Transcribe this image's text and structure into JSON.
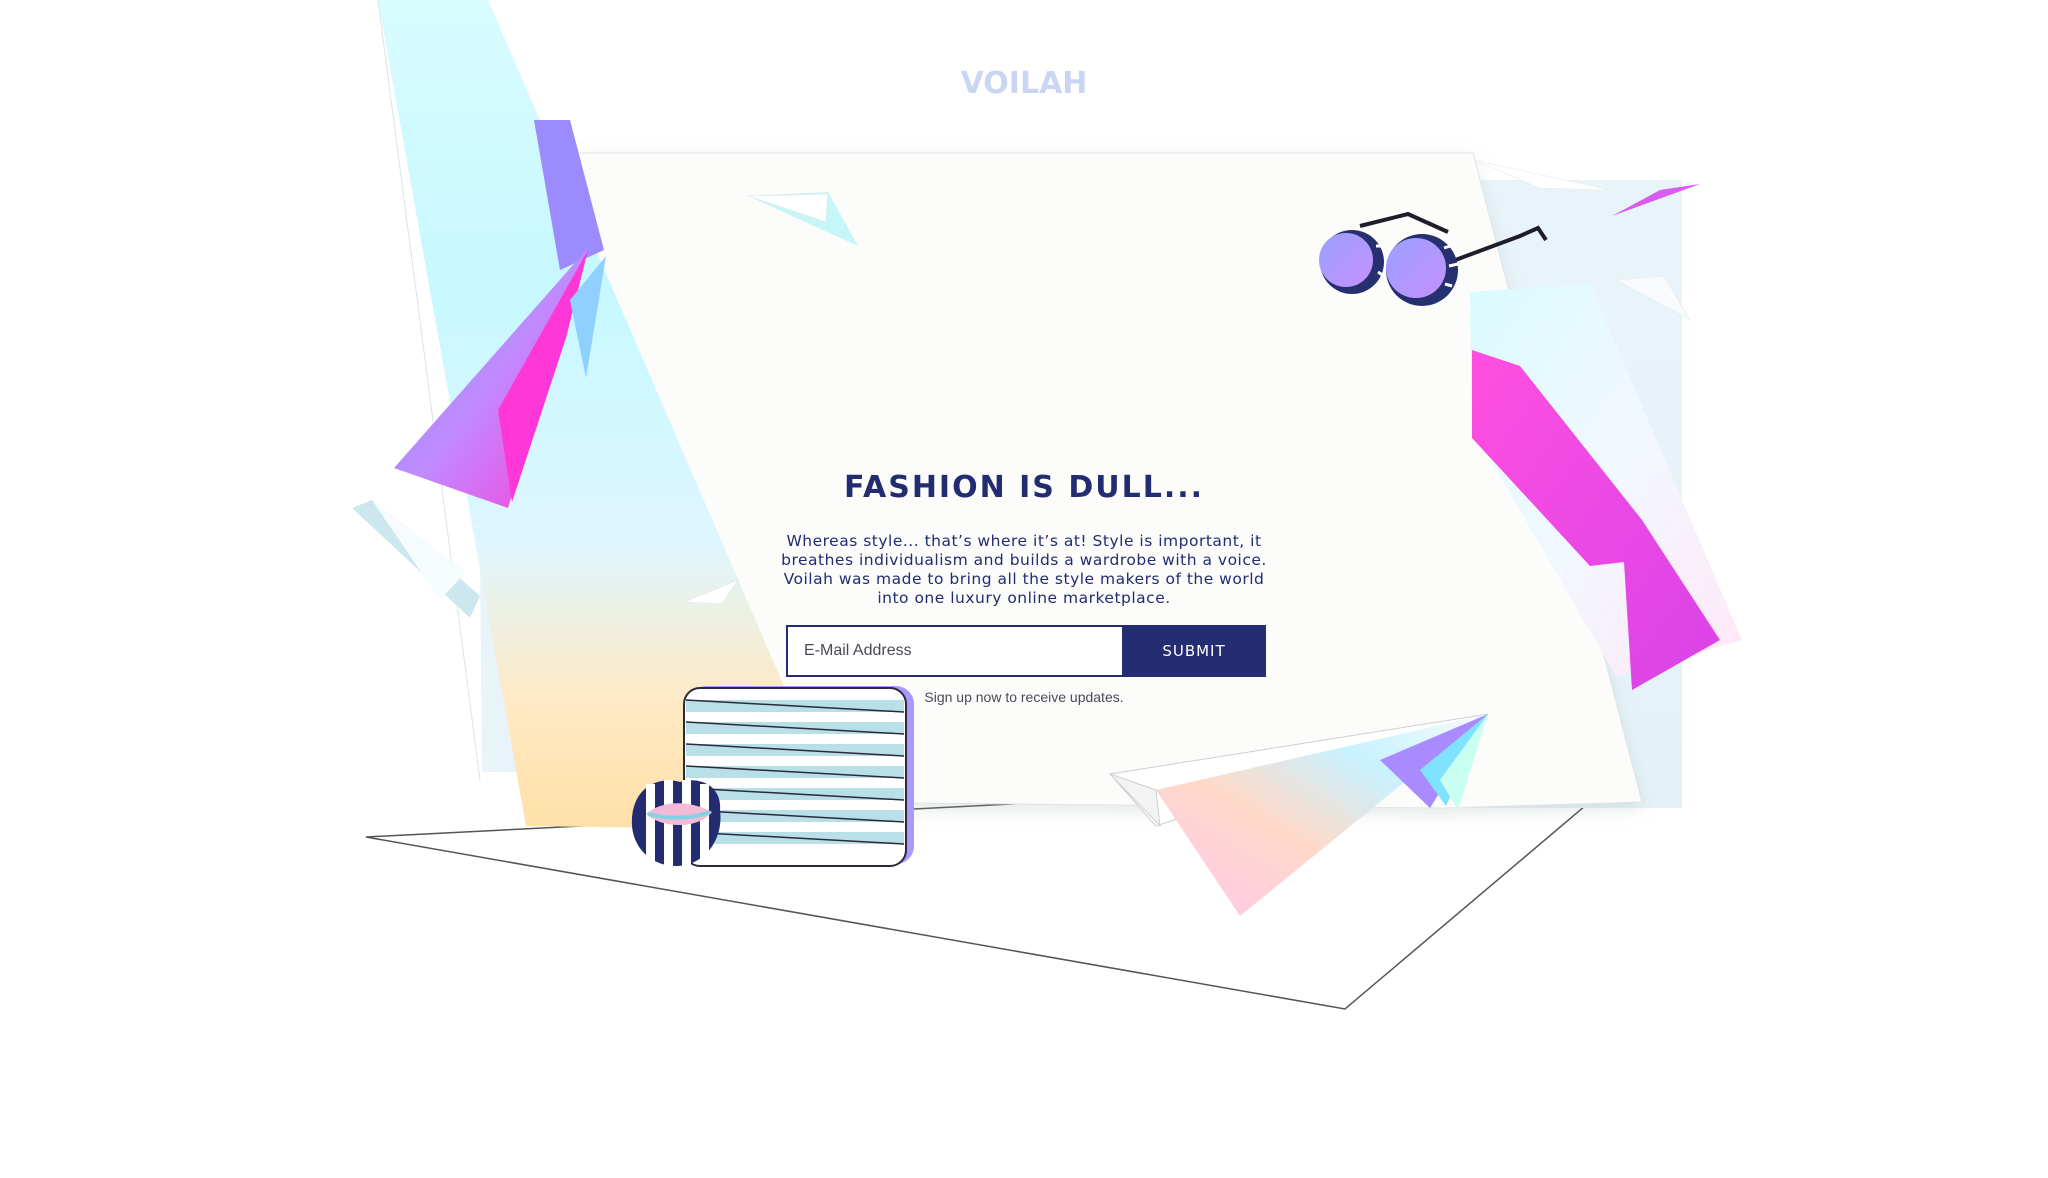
{
  "brand": {
    "logo_text": "VOILAH"
  },
  "hero": {
    "headline": "FASHION IS DULL...",
    "body": "Whereas style... that’s where it’s at! Style is important, it breathes individualism and builds a wardrobe with a voice. Voilah was made to bring all the style makers of the world into one luxury online marketplace."
  },
  "signup": {
    "email_placeholder": "E-Mail Address",
    "email_value": "",
    "submit_label": "SUBMIT",
    "hint": "Sign up now to receive updates."
  },
  "illustration": {
    "items": [
      "holographic-prism-left",
      "sunglasses-icon",
      "notebook-icon",
      "lips-pin-icon",
      "paper-plane-icon",
      "holographic-prism-right"
    ]
  },
  "colors": {
    "navy": "#232c70",
    "magenta": "#ff3fd8",
    "lavender": "#a99bff",
    "aqua": "#c9fbff",
    "peach": "#ffe5b0"
  }
}
